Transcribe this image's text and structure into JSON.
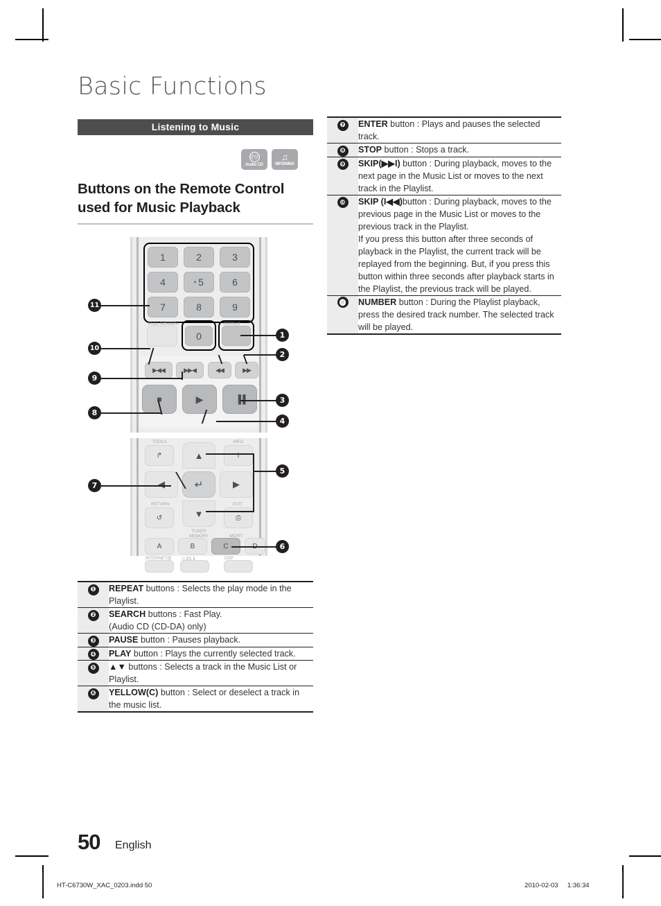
{
  "document": {
    "chapter_title": "Basic Functions",
    "section_bar": "Listening to Music",
    "subheading_line1": "Buttons on the Remote Control",
    "subheading_line2": "used for Music Playback",
    "page_number": "50",
    "language": "English"
  },
  "media_icons": [
    {
      "name": "audio-cd",
      "caption": "Audio CD",
      "glyph": "((•))"
    },
    {
      "name": "mp3-wma",
      "caption": "MP3/WMA",
      "glyph": "♫"
    }
  ],
  "remote": {
    "numbers": [
      "1",
      "2",
      "3",
      "4",
      "5",
      "6",
      "7",
      "8",
      "9"
    ],
    "zero": "0",
    "labels": {
      "full_screen": "FULL SCREEN",
      "repeat": "REPEAT",
      "tools": "TOOLS",
      "info": "INFO",
      "return": "RETURN",
      "exit": "EXIT",
      "tuner_memory": "TUNER\nMEMORY",
      "moist": "MO/ST",
      "internet": "INTERNET@",
      "dolby": "□□PL Ⅱ",
      "dsp": "DSP"
    },
    "transport": {
      "skip_prev": "▶◀◀",
      "skip_next": "▶▶◀",
      "search_rew": "◀◀",
      "search_ff": "▶▶",
      "stop": "■",
      "play": "▶",
      "pause": "▐▐"
    },
    "color_buttons": [
      "A",
      "B",
      "C",
      "D"
    ],
    "dpad": {
      "up": "▲",
      "down": "▼",
      "left": "◀",
      "right": "▶",
      "enter": "↵"
    },
    "callouts": [
      "1",
      "2",
      "3",
      "4",
      "5",
      "6",
      "7",
      "8",
      "9",
      "10",
      "11"
    ]
  },
  "table_left": [
    {
      "num": "❶",
      "parts": [
        {
          "bold": "REPEAT",
          "text": " buttons : Selects the play mode in the Playlist."
        }
      ]
    },
    {
      "num": "❷",
      "parts": [
        {
          "bold": "SEARCH",
          "text": " buttons : Fast Play."
        },
        {
          "bold": "",
          "text": "(Audio CD (CD-DA) only)"
        }
      ]
    },
    {
      "num": "❸",
      "parts": [
        {
          "bold": "PAUSE",
          "text": " button : Pauses playback."
        }
      ]
    },
    {
      "num": "❹",
      "parts": [
        {
          "bold": "PLAY",
          "text": " button : Plays the currently selected track."
        }
      ]
    },
    {
      "num": "❺",
      "parts": [
        {
          "bold": "▲▼",
          "text": " buttons : Selects a track in the Music List or Playlist."
        }
      ]
    },
    {
      "num": "❻",
      "parts": [
        {
          "bold": "YELLOW(C)",
          "text": " button : Select or deselect a track in the music list."
        }
      ]
    }
  ],
  "table_right": [
    {
      "num": "❼",
      "parts": [
        {
          "bold": "ENTER",
          "text": " button : Plays and pauses the selected track."
        }
      ]
    },
    {
      "num": "❽",
      "parts": [
        {
          "bold": "STOP",
          "text": " button : Stops a track."
        }
      ]
    },
    {
      "num": "❾",
      "parts": [
        {
          "bold": "SKIP(▶▶I)",
          "text": " button : During playback, moves to the next page in the Music List or moves to the next track in the Playlist."
        }
      ]
    },
    {
      "num": "❿",
      "parts": [
        {
          "bold": "SKIP (I◀◀)",
          "text": "button : During playback, moves to the previous page in the Music List or moves to the previous track in the Playlist."
        },
        {
          "bold": "",
          "text": "If you press this button after three seconds of playback in the Playlist, the current track will be replayed from the beginning. But, if you press this button within three seconds after playback starts in the Playlist, the previous track will be played."
        }
      ]
    },
    {
      "num": "⓫",
      "parts": [
        {
          "bold": "NUMBER",
          "text": " button : During the Playlist playback, press the desired track number. The selected track will be played."
        }
      ]
    }
  ],
  "footer": {
    "file": "HT-C6730W_XAC_0203.indd   50",
    "date": "2010-02-03",
    "time": "1:36:34"
  },
  "colors": {
    "section_bar_bg": "#4e4c4d",
    "ink": "#231f20",
    "rule": "#bcbec0",
    "remote_body": "#ededee",
    "button_gray": "#c3c4c6"
  }
}
